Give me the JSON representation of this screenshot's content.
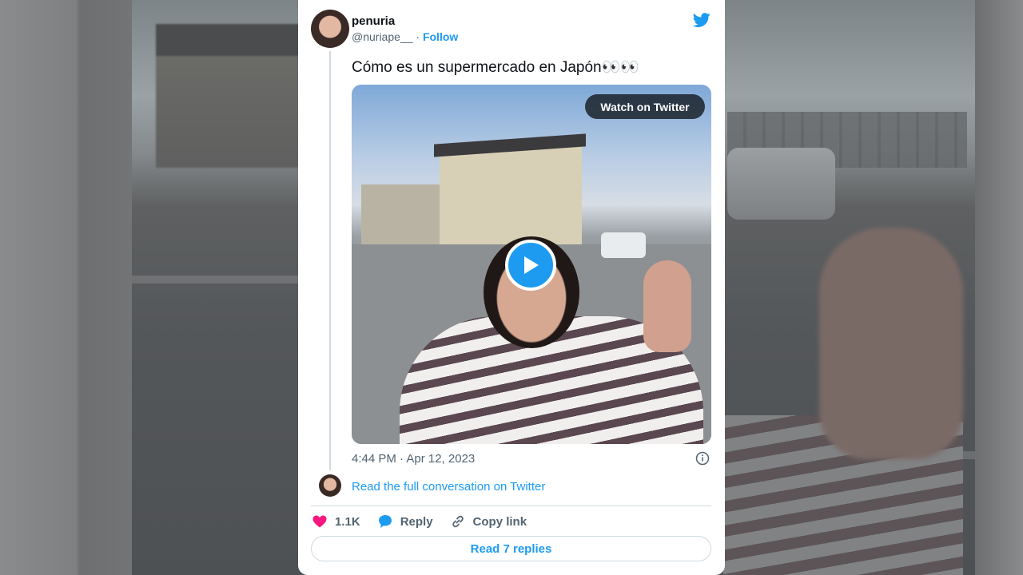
{
  "tweet": {
    "author_name": "penuria",
    "author_handle": "@nuriape__",
    "separator": "·",
    "follow_label": "Follow",
    "text": "Cómo es un supermercado en Japón👀👀",
    "media": {
      "watch_label": "Watch on Twitter"
    },
    "timestamp": "4:44 PM · Apr 12, 2023",
    "read_conversation_label": "Read the full conversation on Twitter",
    "actions": {
      "like_count": "1.1K",
      "reply_label": "Reply",
      "copy_link_label": "Copy link"
    },
    "read_replies_label": "Read 7 replies"
  },
  "colors": {
    "accent": "#1d9bf0",
    "like": "#f91880",
    "text": "#0f1419",
    "secondary": "#536471"
  }
}
